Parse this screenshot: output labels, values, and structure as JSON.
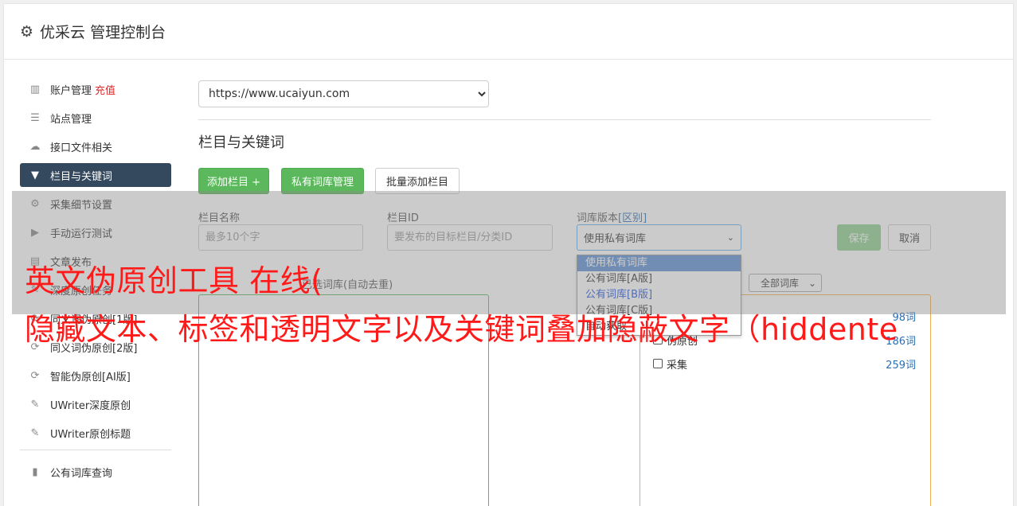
{
  "header": {
    "title": "优采云 管理控制台",
    "icon": "gear-icon"
  },
  "sidebar": {
    "items": [
      {
        "label": "账户管理",
        "extra": "充值",
        "icon": "bar-chart-icon"
      },
      {
        "label": "站点管理",
        "icon": "server-icon"
      },
      {
        "label": "接口文件相关",
        "icon": "cloud-upload-icon"
      },
      {
        "label": "栏目与关键词",
        "icon": "filter-icon",
        "active": true
      },
      {
        "label": "采集细节设置",
        "icon": "cogs-icon"
      },
      {
        "label": "手动运行测试",
        "icon": "play-circle-icon"
      },
      {
        "label": "文章发布",
        "icon": "file-icon"
      },
      {
        "label": "深度原创任务",
        "icon": "edit-icon"
      },
      {
        "label": "同义词伪原创[1版]",
        "icon": "refresh-icon"
      },
      {
        "label": "同义词伪原创[2版]",
        "icon": "refresh-icon"
      },
      {
        "label": "智能伪原创[AI版]",
        "icon": "refresh-icon"
      },
      {
        "label": "UWriter深度原创",
        "icon": "edit-icon"
      },
      {
        "label": "UWriter原创标题",
        "icon": "edit-icon"
      }
    ],
    "bottom_items": [
      {
        "label": "公有词库查询",
        "icon": "book-icon"
      }
    ]
  },
  "main": {
    "site_select": "https://www.ucaiyun.com",
    "section_title": "栏目与关键词",
    "buttons": {
      "add_column": "添加栏目 +",
      "private_lib": "私有词库管理",
      "batch_add": "批量添加栏目"
    },
    "form": {
      "name_label": "栏目名称",
      "name_placeholder": "最多10个字",
      "id_label": "栏目ID",
      "id_placeholder": "要发布的目标栏目/分类ID",
      "version_label": "词库版本",
      "version_link": "[区别]",
      "version_value": "使用私有词库",
      "save": "保存",
      "cancel": "取消"
    },
    "dropdown_options": [
      "使用私有词库",
      "公有词库[A版]",
      "公有词库[B版]",
      "公有词库[C版]",
      "自动获取"
    ],
    "left_panel_label": "已选词库(自动去重)",
    "lib_filter": "全部词库",
    "libraries": [
      {
        "name": "测试",
        "count": "98词"
      },
      {
        "name": "伪原创",
        "count": "186词"
      },
      {
        "name": "采集",
        "count": "259词"
      }
    ]
  },
  "ad_overlay": {
    "line1": "英文伪原创工具 在线(",
    "line2": "隐藏文本、标签和透明文字以及关键词叠加隐蔽文字（hiddente"
  }
}
